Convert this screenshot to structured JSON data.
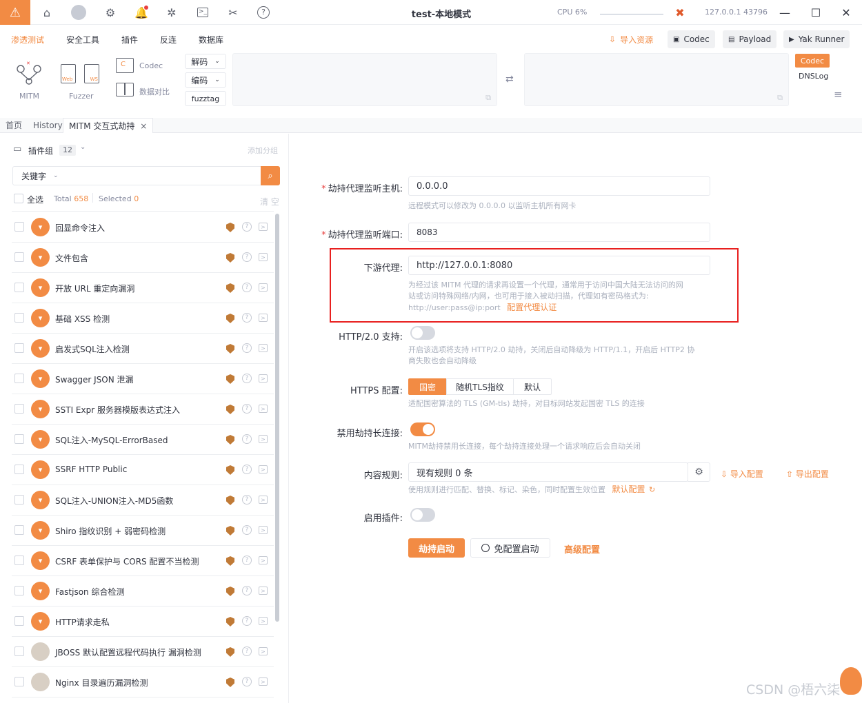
{
  "titlebar": {
    "title": "test-本地模式",
    "cpu": "CPU 6%",
    "ip_port": "127.0.0.1 43796"
  },
  "menu": {
    "items": [
      "渗透测试",
      "安全工具",
      "插件",
      "反连",
      "数据库"
    ],
    "active": "渗透测试",
    "import_resource": "导入资源",
    "codec": "Codec",
    "payload": "Payload",
    "yak_runner": "Yak Runner"
  },
  "toolbar": {
    "mitm_label": "MITM",
    "fuzzer_label": "Fuzzer",
    "web_label": "Web",
    "ws_label": "WS",
    "codec_label": "Codec",
    "compare_label": "数据对比",
    "decode": "解码",
    "encode": "编码",
    "fuzztag": "fuzztag",
    "side_codec": "Codec",
    "side_dnslog": "DNSLog"
  },
  "tabs": [
    {
      "label": "首页"
    },
    {
      "label": "History"
    },
    {
      "label": "MITM 交互式劫持"
    }
  ],
  "left": {
    "group_label": "插件组",
    "group_count": "12",
    "add_group": "添加分组",
    "keyword": "关键字",
    "search_placeholder": "",
    "select_all": "全选",
    "total_label": "Total",
    "total_value": "658",
    "selected_label": "Selected",
    "selected_value": "0",
    "clear": "清 空",
    "plugins": [
      {
        "name": "回显命令注入"
      },
      {
        "name": "文件包含"
      },
      {
        "name": "开放 URL 重定向漏洞"
      },
      {
        "name": "基础 XSS 检测"
      },
      {
        "name": "启发式SQL注入检测"
      },
      {
        "name": "Swagger JSON 泄漏"
      },
      {
        "name": "SSTI Expr 服务器模版表达式注入"
      },
      {
        "name": "SQL注入-MySQL-ErrorBased"
      },
      {
        "name": "SSRF HTTP Public"
      },
      {
        "name": "SQL注入-UNION注入-MD5函数"
      },
      {
        "name": "Shiro 指纹识别 + 弱密码检测"
      },
      {
        "name": "CSRF 表单保护与 CORS 配置不当检测"
      },
      {
        "name": "Fastjson 综合检测"
      },
      {
        "name": "HTTP请求走私"
      },
      {
        "name": "JBOSS 默认配置远程代码执行 漏洞检测"
      },
      {
        "name": "Nginx 目录遍历漏洞检测"
      }
    ]
  },
  "form": {
    "host_label": "劫持代理监听主机:",
    "host_value": "0.0.0.0",
    "host_help": "远程模式可以修改为 0.0.0.0 以监听主机所有网卡",
    "port_label": "劫持代理监听端口:",
    "port_value": "8083",
    "downstream_label": "下游代理:",
    "downstream_value": "http://127.0.0.1:8080",
    "downstream_help_1": "为经过该 MITM 代理的请求再设置一个代理，通常用于访问中国大陆无法访问的网",
    "downstream_help_2": "站或访问特殊网络/内网，也可用于接入被动扫描，代理如有密码格式为:",
    "downstream_help_3": "http://user:pass@ip:port",
    "downstream_auth": "配置代理认证",
    "http2_label": "HTTP/2.0 支持:",
    "http2_help_1": "开启该选项将支持 HTTP/2.0 劫持，关闭后自动降级为 HTTP/1.1，开启后 HTTP2 协",
    "http2_help_2": "商失败也会自动降级",
    "https_label": "HTTPS 配置:",
    "https_options": [
      "国密",
      "随机TLS指纹",
      "默认"
    ],
    "https_help": "适配国密算法的 TLS (GM-tls) 劫持，对目标网站发起国密 TLS 的连接",
    "keepalive_label": "禁用劫持长连接:",
    "keepalive_help": "MITM劫持禁用长连接，每个劫持连接处理一个请求响应后会自动关闭",
    "rules_label": "内容规则:",
    "rules_value": "现有规则 0 条",
    "import_config": "导入配置",
    "export_config": "导出配置",
    "rules_help": "使用规则进行匹配、替换、标记、染色，同时配置生效位置",
    "default_config": "默认配置",
    "plugin_label": "启用插件:",
    "start_btn": "劫持启动",
    "nocfg_btn": "免配置启动",
    "advanced": "高级配置"
  },
  "watermark": "CSDN @梧六柒"
}
